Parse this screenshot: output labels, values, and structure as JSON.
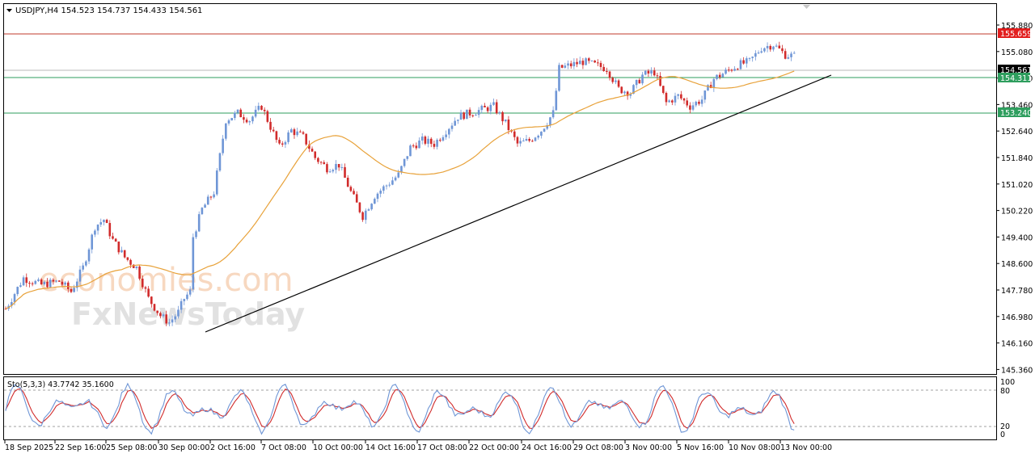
{
  "chart_data": {
    "type": "candlestick",
    "symbol_header": "USDJPY,H4  154.523 154.737 154.433 154.561",
    "y_ticks": [
      "155.880",
      "155.080",
      "154.260",
      "153.460",
      "152.640",
      "151.840",
      "151.020",
      "150.220",
      "149.400",
      "148.600",
      "147.780",
      "146.980",
      "146.160",
      "145.360"
    ],
    "ylim": [
      145.3,
      156.1
    ],
    "x_ticks": [
      "18 Sep 2025",
      "22 Sep 16:00",
      "25 Sep 08:00",
      "30 Sep 00:00",
      "2 Oct 16:00",
      "7 Oct 08:00",
      "10 Oct 00:00",
      "14 Oct 16:00",
      "17 Oct 08:00",
      "22 Oct 00:00",
      "24 Oct 16:00",
      "29 Oct 08:00",
      "3 Nov 00:00",
      "5 Nov 16:00",
      "10 Nov 08:00",
      "13 Nov 00:00"
    ],
    "horizontal_levels": [
      {
        "value": 155.659,
        "label": "155.659",
        "color": "#c0392b"
      },
      {
        "value": 154.311,
        "label": "154.311",
        "color": "#2e9e5e"
      },
      {
        "value": 153.24,
        "label": "153.240",
        "color": "#2e9e5e"
      }
    ],
    "current_price": {
      "value": 154.561,
      "label": "154.561"
    },
    "trendline": {
      "start": {
        "date": "30 Sep 00:00",
        "value": 146.6
      },
      "end": {
        "date": "13 Nov 16:00",
        "value": 154.4
      }
    },
    "ma_color": "#e8a23a",
    "bull_color": "#6f96d6",
    "bear_color": "#d12b2b",
    "oscillator": {
      "header": "Sto(5,3,3) 43.7742 35.1600",
      "levels": [
        "100",
        "80",
        "20",
        "0"
      ],
      "main_color": "#6f96d6",
      "signal_color": "#d12b2b"
    },
    "watermark": {
      "line1": "economies.com",
      "line2": "FxNewsToday"
    }
  }
}
